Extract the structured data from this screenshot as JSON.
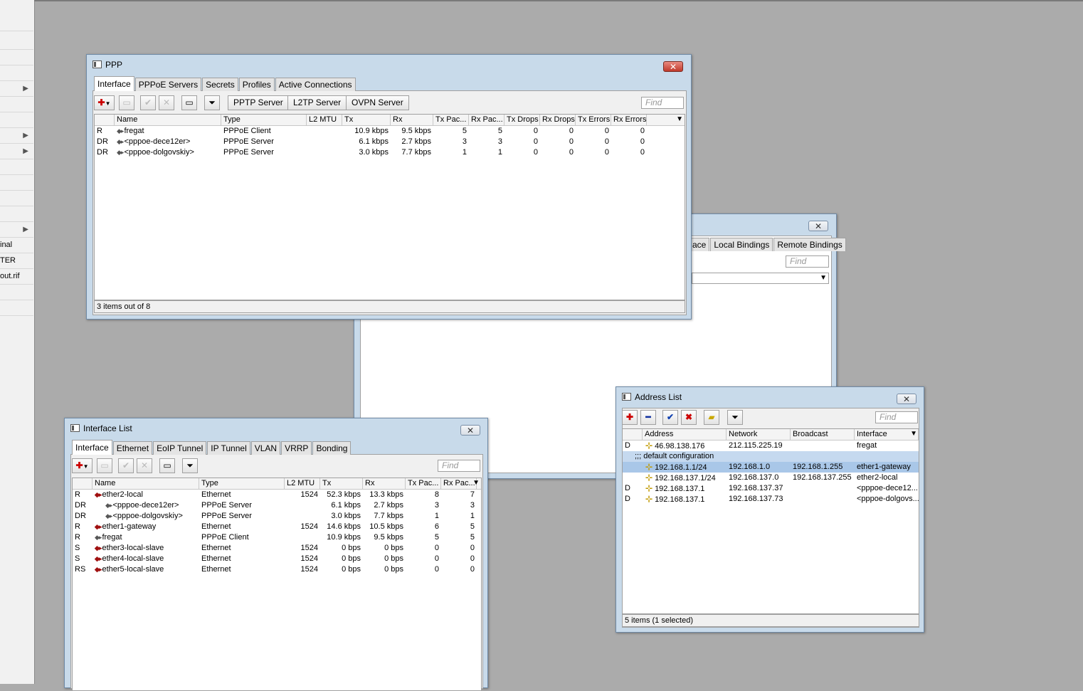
{
  "sidebar": {
    "items": [
      {
        "text": "",
        "arrow": ""
      },
      {
        "text": "",
        "arrow": ""
      },
      {
        "text": "",
        "arrow": ""
      },
      {
        "text": "",
        "arrow": ""
      },
      {
        "text": "",
        "arrow": "▶"
      },
      {
        "text": "",
        "arrow": ""
      },
      {
        "text": "",
        "arrow": ""
      },
      {
        "text": "",
        "arrow": "▶"
      },
      {
        "text": "",
        "arrow": "▶"
      },
      {
        "text": "",
        "arrow": ""
      },
      {
        "text": "",
        "arrow": ""
      },
      {
        "text": "",
        "arrow": ""
      },
      {
        "text": "",
        "arrow": ""
      },
      {
        "text": "",
        "arrow": "▶"
      },
      {
        "text": "inal",
        "arrow": ""
      },
      {
        "text": "TER",
        "arrow": ""
      },
      {
        "text": "out.rif",
        "arrow": ""
      },
      {
        "text": "",
        "arrow": ""
      },
      {
        "text": "",
        "arrow": ""
      }
    ]
  },
  "ppp": {
    "title": "PPP",
    "tabs": [
      "Interface",
      "PPPoE Servers",
      "Secrets",
      "Profiles",
      "Active Connections"
    ],
    "buttons": {
      "pptp": "PPTP Server",
      "l2tp": "L2TP Server",
      "ovpn": "OVPN Server"
    },
    "find_placeholder": "Find",
    "columns": [
      "",
      "Name",
      "Type",
      "L2 MTU",
      "Tx",
      "Rx",
      "Tx Pac...",
      "Rx Pac...",
      "Tx Drops",
      "Rx Drops",
      "Tx Errors",
      "Rx Errors"
    ],
    "rows": [
      {
        "flag": "R",
        "name": "fregat",
        "type": "PPPoE Client",
        "mtu": "",
        "tx": "10.9 kbps",
        "rx": "9.5 kbps",
        "txp": "5",
        "rxp": "5",
        "txd": "0",
        "rxd": "0",
        "txe": "0",
        "rxe": "0"
      },
      {
        "flag": "DR",
        "name": "<pppoe-dece12er>",
        "type": "PPPoE Server",
        "mtu": "",
        "tx": "6.1 kbps",
        "rx": "2.7 kbps",
        "txp": "3",
        "rxp": "3",
        "txd": "0",
        "rxd": "0",
        "txe": "0",
        "rxe": "0"
      },
      {
        "flag": "DR",
        "name": "<pppoe-dolgovskiy>",
        "type": "PPPoE Server",
        "mtu": "",
        "tx": "3.0 kbps",
        "rx": "7.7 kbps",
        "txp": "1",
        "rxp": "1",
        "txd": "0",
        "rxd": "0",
        "txe": "0",
        "rxe": "0"
      }
    ],
    "status": "3 items out of 8"
  },
  "back": {
    "tabs": [
      "ace",
      "Local Bindings",
      "Remote Bindings"
    ],
    "find_placeholder": "Find"
  },
  "iflist": {
    "title": "Interface List",
    "tabs": [
      "Interface",
      "Ethernet",
      "EoIP Tunnel",
      "IP Tunnel",
      "VLAN",
      "VRRP",
      "Bonding"
    ],
    "find_placeholder": "Find",
    "columns": [
      "",
      "Name",
      "Type",
      "L2 MTU",
      "Tx",
      "Rx",
      "Tx Pac...",
      "Rx Pac..."
    ],
    "rows": [
      {
        "flag": "R",
        "name": "ether2-local",
        "type": "Ethernet",
        "mtu": "1524",
        "tx": "52.3 kbps",
        "rx": "13.3 kbps",
        "txp": "8",
        "rxp": "7",
        "eth": true,
        "indent": false
      },
      {
        "flag": "DR",
        "name": "<pppoe-dece12er>",
        "type": "PPPoE Server",
        "mtu": "",
        "tx": "6.1 kbps",
        "rx": "2.7 kbps",
        "txp": "3",
        "rxp": "3",
        "eth": false,
        "indent": true
      },
      {
        "flag": "DR",
        "name": "<pppoe-dolgovskiy>",
        "type": "PPPoE Server",
        "mtu": "",
        "tx": "3.0 kbps",
        "rx": "7.7 kbps",
        "txp": "1",
        "rxp": "1",
        "eth": false,
        "indent": true
      },
      {
        "flag": "R",
        "name": "ether1-gateway",
        "type": "Ethernet",
        "mtu": "1524",
        "tx": "14.6 kbps",
        "rx": "10.5 kbps",
        "txp": "6",
        "rxp": "5",
        "eth": true,
        "indent": false
      },
      {
        "flag": "R",
        "name": "fregat",
        "type": "PPPoE Client",
        "mtu": "",
        "tx": "10.9 kbps",
        "rx": "9.5 kbps",
        "txp": "5",
        "rxp": "5",
        "eth": false,
        "indent": false
      },
      {
        "flag": "S",
        "name": "ether3-local-slave",
        "type": "Ethernet",
        "mtu": "1524",
        "tx": "0 bps",
        "rx": "0 bps",
        "txp": "0",
        "rxp": "0",
        "eth": true,
        "indent": false
      },
      {
        "flag": "S",
        "name": "ether4-local-slave",
        "type": "Ethernet",
        "mtu": "1524",
        "tx": "0 bps",
        "rx": "0 bps",
        "txp": "0",
        "rxp": "0",
        "eth": true,
        "indent": false
      },
      {
        "flag": "RS",
        "name": "ether5-local-slave",
        "type": "Ethernet",
        "mtu": "1524",
        "tx": "0 bps",
        "rx": "0 bps",
        "txp": "0",
        "rxp": "0",
        "eth": true,
        "indent": false
      }
    ]
  },
  "addr": {
    "title": "Address List",
    "find_placeholder": "Find",
    "columns": [
      "",
      "Address",
      "Network",
      "Broadcast",
      "Interface"
    ],
    "rows": [
      {
        "flag": "D",
        "address": "46.98.138.176",
        "network": "212.115.225.19",
        "broadcast": "",
        "iface": "fregat",
        "comment": "",
        "selected": false
      },
      {
        "flag": "",
        "address": "",
        "network": "",
        "broadcast": "",
        "iface": "",
        "comment": ";;; default configuration",
        "selected": false
      },
      {
        "flag": "",
        "address": "192.168.1.1/24",
        "network": "192.168.1.0",
        "broadcast": "192.168.1.255",
        "iface": "ether1-gateway",
        "comment": "",
        "selected": true
      },
      {
        "flag": "",
        "address": "192.168.137.1/24",
        "network": "192.168.137.0",
        "broadcast": "192.168.137.255",
        "iface": "ether2-local",
        "comment": "",
        "selected": false
      },
      {
        "flag": "D",
        "address": "192.168.137.1",
        "network": "192.168.137.37",
        "broadcast": "",
        "iface": "<pppoe-dece12...",
        "comment": "",
        "selected": false
      },
      {
        "flag": "D",
        "address": "192.168.137.1",
        "network": "192.168.137.73",
        "broadcast": "",
        "iface": "<pppoe-dolgovs...",
        "comment": "",
        "selected": false
      }
    ],
    "status": "5 items (1 selected)"
  }
}
